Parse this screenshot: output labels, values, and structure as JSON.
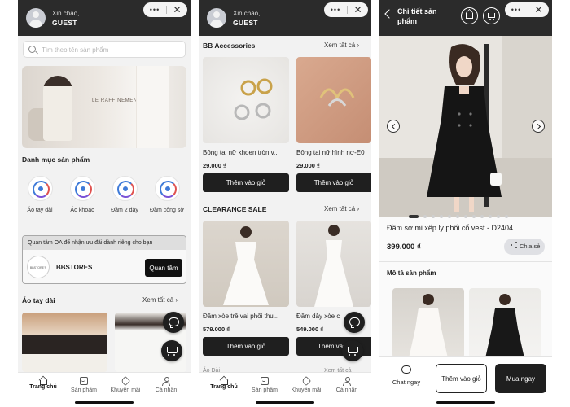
{
  "header": {
    "greeting": "Xin chào,",
    "username": "GUEST",
    "menu_dots": "•••",
    "close": "✕"
  },
  "search": {
    "placeholder": "Tìm theo tên sản phẩm"
  },
  "banner": {
    "brand_text": "LE RAFFINEMENT"
  },
  "categories": {
    "title": "Danh mục sản phẩm",
    "items": [
      {
        "label": "Áo tay dài"
      },
      {
        "label": "Áo khoác"
      },
      {
        "label": "Đầm 2 dây"
      },
      {
        "label": "Đầm công sở"
      }
    ]
  },
  "promo": {
    "text": "Quan tâm OA để nhận ưu đãi dành riêng cho bạn",
    "logo_text": "BBSTORE'S",
    "store_name": "BBSTORES",
    "follow_label": "Quan tâm"
  },
  "sections": {
    "long_sleeve": {
      "title": "Áo tay dài",
      "see_all": "Xem tất cả"
    },
    "accessories": {
      "title": "BB Accessories",
      "see_all": "Xem tất cả"
    },
    "clearance": {
      "title": "CLEARANCE SALE",
      "see_all": "Xem tất cả"
    },
    "next_partial": {
      "title": "Áo Dài",
      "see_all": "Xem tất cả"
    }
  },
  "accessories_products": [
    {
      "name": "Bông tai nữ khoen tròn v...",
      "price": "29.000 ₫",
      "button": "Thêm vào giỏ"
    },
    {
      "name": "Bông tai nữ hình nơ-E0",
      "price": "29.000 ₫",
      "button": "Thêm vào giỏ"
    }
  ],
  "clearance_products": [
    {
      "name": "Đầm xòe trễ vai phối thu...",
      "price": "579.000 ₫",
      "button": "Thêm vào giỏ"
    },
    {
      "name": "Đầm dây xòe c",
      "price": "549.000 ₫",
      "button": "Thêm vào"
    }
  ],
  "tabbar": {
    "items": [
      {
        "label": "Trang chủ",
        "icon": "home-icon",
        "active": true
      },
      {
        "label": "Sản phẩm",
        "icon": "shop-icon",
        "active": false
      },
      {
        "label": "Khuyến mãi",
        "icon": "tag-icon",
        "active": false
      },
      {
        "label": "Cá nhân",
        "icon": "person-icon",
        "active": false
      }
    ]
  },
  "detail": {
    "title": "Chi tiết sản phẩm",
    "product_name": "Đầm sơ mi xếp ly phối cổ vest - D2404",
    "price": "399.000 ₫",
    "share_label": "Chia sẻ",
    "description_title": "Mô tả sản phẩm",
    "chat_label": "Chat ngay",
    "add_to_cart_label": "Thêm vào giỏ",
    "buy_now_label": "Mua ngay",
    "gallery_count": 12,
    "gallery_active_index": 0
  },
  "colors": {
    "header_bg": "#2b2b2b",
    "primary_button": "#1f1f1f",
    "screen_bg": "#f2f2f2",
    "accent_blue": "#3e7ad8"
  }
}
